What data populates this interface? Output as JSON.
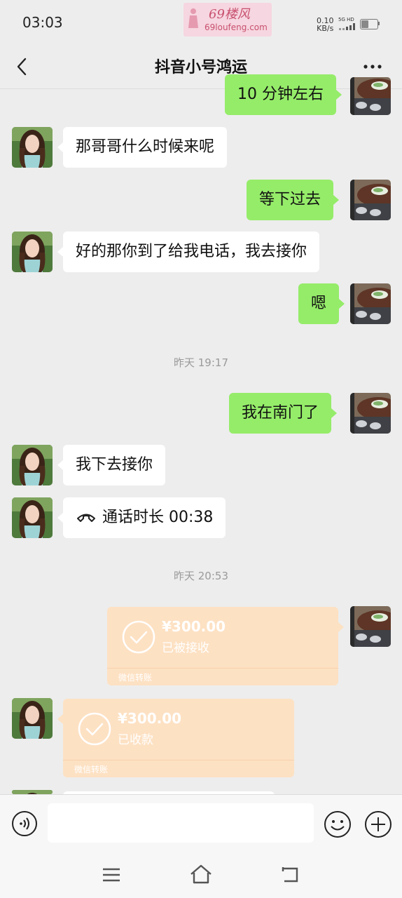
{
  "status_bar": {
    "time": "03:03",
    "watermark_title": "69楼风",
    "watermark_url": "69loufeng.com",
    "net_speed_value": "0.10",
    "net_speed_unit": "KB/s",
    "signal_label": "5G HD",
    "battery_level": 0.42
  },
  "header": {
    "back_icon": "chevron-left-icon",
    "title": "抖音小号鸿运",
    "more_icon": "more-dots-icon"
  },
  "colors": {
    "bubble_sent": "#95ec69",
    "bubble_received": "#ffffff",
    "transfer_card": "#fde1c3",
    "background": "#ededed"
  },
  "messages": [
    {
      "from": "me",
      "text": "10 分钟左右"
    },
    {
      "from": "other",
      "text": "那哥哥什么时候来呢"
    },
    {
      "from": "me",
      "text": "等下过去"
    },
    {
      "from": "other",
      "text": "好的那你到了给我电话，我去接你"
    },
    {
      "from": "me",
      "text": "嗯"
    },
    {
      "timestamp": "昨天 19:17"
    },
    {
      "from": "me",
      "text": "我在南门了"
    },
    {
      "from": "other",
      "text": "我下去接你"
    },
    {
      "from": "other",
      "call_icon": "phone-handset-icon",
      "text": "通话时长 00:38"
    },
    {
      "timestamp": "昨天 20:53"
    },
    {
      "from": "me",
      "transfer": {
        "amount": "¥300.00",
        "status": "已被接收",
        "label": "微信转账"
      }
    },
    {
      "from": "other",
      "transfer": {
        "amount": "¥300.00",
        "status": "已收款",
        "label": "微信转账"
      }
    }
  ],
  "input_bar": {
    "voice_icon": "voice-icon",
    "emoji_icon": "emoji-icon",
    "plus_icon": "plus-icon"
  },
  "nav_bar": {
    "menu_icon": "menu-icon",
    "home_icon": "home-icon",
    "back_icon": "back-icon"
  }
}
